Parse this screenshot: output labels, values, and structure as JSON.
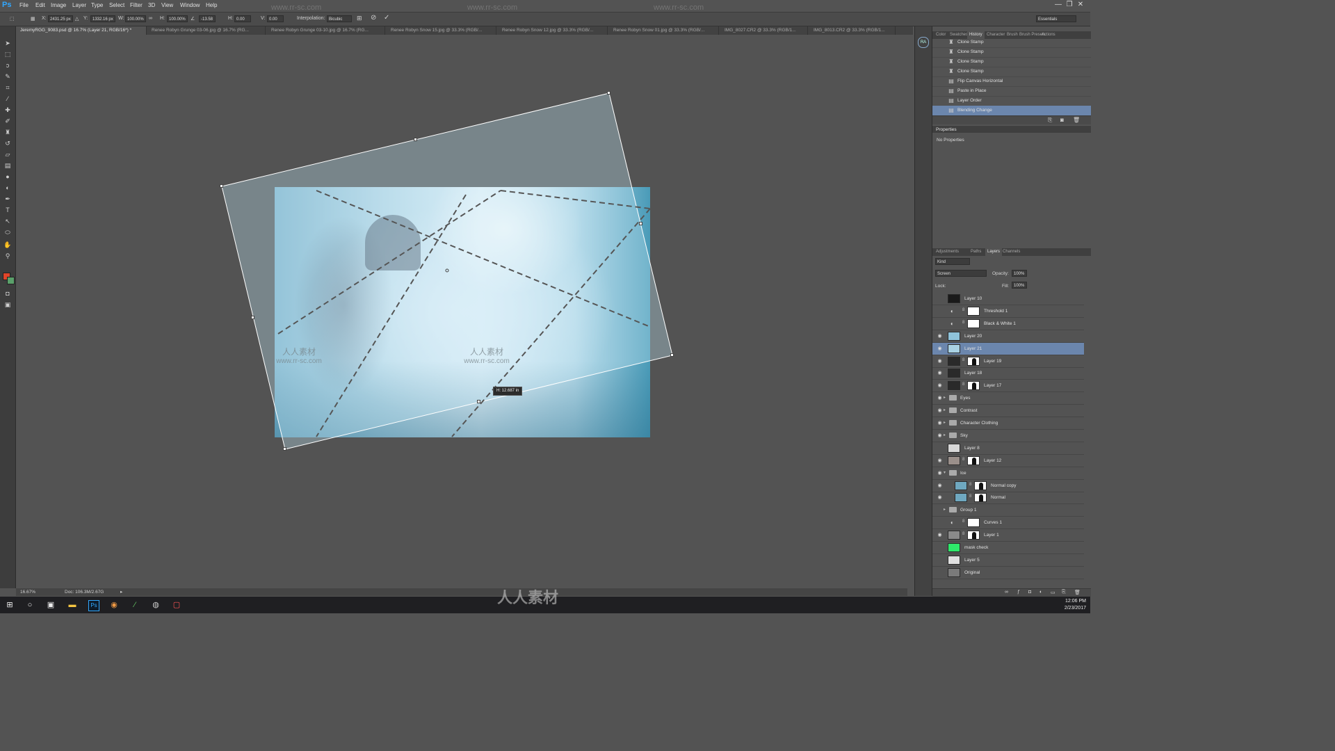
{
  "app": {
    "logo": "Ps",
    "menu": [
      "File",
      "Edit",
      "Image",
      "Layer",
      "Type",
      "Select",
      "Filter",
      "3D",
      "View",
      "Window",
      "Help"
    ],
    "window_controls": [
      "—",
      "❐",
      "✕"
    ]
  },
  "options_bar": {
    "x_label": "X:",
    "x_value": "2431.25 px",
    "y_label": "Y:",
    "y_value": "1332.16 px",
    "w_label": "W:",
    "w_value": "100.00%",
    "h_label": "H:",
    "h_value": "100.00%",
    "angle_value": "-13.58",
    "hskew_label": "H:",
    "hskew_value": "0.00",
    "vskew_label": "V:",
    "vskew_value": "0.00",
    "interpolation_label": "Interpolation:",
    "interpolation_value": "Bicubic",
    "workspace": "Essentials"
  },
  "document_tabs": [
    {
      "label": "JeremyRGG_9083.psd @ 16.7% (Layer 21, RGB/16*) *",
      "active": true
    },
    {
      "label": "Renee Robyn Grunge 03-06.jpg @ 16.7% (RG..."
    },
    {
      "label": "Renee Robyn Grunge 03-10.jpg @ 16.7% (RG..."
    },
    {
      "label": "Renee Robyn Snow 15.jpg @ 33.3% (RGB/..."
    },
    {
      "label": "Renee Robyn Snow 12.jpg @ 33.3% (RGB/..."
    },
    {
      "label": "Renee Robyn Snow 01.jpg @ 33.3% (RGB/..."
    },
    {
      "label": "IMG_8027.CR2 @ 33.3% (RGB/1..."
    },
    {
      "label": "IMG_8013.CR2 @ 33.3% (RGB/1..."
    }
  ],
  "canvas": {
    "measure_tooltip": "H: 12.687 in",
    "watermark_cn": "人人素材",
    "watermark_url": "www.rr-sc.com"
  },
  "status_bar": {
    "zoom": "16.67%",
    "doc_size": "Doc: 106.3M/2.67G"
  },
  "right_strip": {
    "ra_button": "RA"
  },
  "history_panel": {
    "tabs": [
      "Color",
      "Swatches",
      "History",
      "Character",
      "Brush",
      "Brush Presets",
      "Actions"
    ],
    "active_tab": "History",
    "items": [
      {
        "label": "Clone Stamp",
        "icon": "stamp-icon"
      },
      {
        "label": "Clone Stamp",
        "icon": "stamp-icon"
      },
      {
        "label": "Clone Stamp",
        "icon": "stamp-icon"
      },
      {
        "label": "Clone Stamp",
        "icon": "stamp-icon"
      },
      {
        "label": "Flip Canvas Horizontal",
        "icon": "doc-icon"
      },
      {
        "label": "Paste in Place",
        "icon": "doc-icon"
      },
      {
        "label": "Layer Order",
        "icon": "doc-icon"
      },
      {
        "label": "Blending Change",
        "icon": "doc-icon",
        "active": true
      }
    ]
  },
  "properties_panel": {
    "title": "Properties",
    "message": "No Properties"
  },
  "layers_panel": {
    "tabs": [
      "Adjustments",
      "Paths",
      "Layers",
      "Channels"
    ],
    "active_tab": "Layers",
    "filter_kind": "Kind",
    "blend_mode": "Screen",
    "opacity_label": "Opacity:",
    "opacity_value": "100%",
    "lock_label": "Lock:",
    "fill_label": "Fill:",
    "fill_value": "100%",
    "layers": [
      {
        "name": "Layer 10",
        "visible": false,
        "thumb": "#1a1a1a"
      },
      {
        "name": "Threshold 1",
        "visible": false,
        "adjustment": true,
        "mask": "white"
      },
      {
        "name": "Black & White 1",
        "visible": false,
        "adjustment": true,
        "mask": "white"
      },
      {
        "name": "Layer 20",
        "visible": true,
        "thumb": "#8fc3da"
      },
      {
        "name": "Layer 21",
        "visible": true,
        "thumb": "#a9d2e4",
        "active": true
      },
      {
        "name": "Layer 19",
        "visible": true,
        "thumb": "#2a2a2a",
        "mask": "dark"
      },
      {
        "name": "Layer 18",
        "visible": true,
        "thumb": "#2a2a2a"
      },
      {
        "name": "Layer 17",
        "visible": true,
        "thumb": "#2a2a2a",
        "mask": "dark"
      },
      {
        "name": "Eyes",
        "visible": true,
        "group": true
      },
      {
        "name": "Contrast",
        "visible": true,
        "group": true
      },
      {
        "name": "Character Clothing",
        "visible": true,
        "group": true
      },
      {
        "name": "Sky",
        "visible": true,
        "group": true
      },
      {
        "name": "Layer 8",
        "visible": false,
        "thumb": "#d8d8d8"
      },
      {
        "name": "Layer 12",
        "visible": true,
        "thumb": "#9a8f8a",
        "mask": "dark"
      },
      {
        "name": "Ice",
        "visible": true,
        "group": true,
        "open": true
      },
      {
        "name": "Normal copy",
        "visible": true,
        "thumb": "#6fa8c0",
        "mask": "dark",
        "indent": true
      },
      {
        "name": "Normal",
        "visible": true,
        "thumb": "#6fa8c0",
        "mask": "dark",
        "indent": true
      },
      {
        "name": "Group 1",
        "visible": false,
        "group": true
      },
      {
        "name": "Curves 1",
        "visible": false,
        "adjustment": true,
        "mask": "white"
      },
      {
        "name": "Layer 1",
        "visible": true,
        "thumb": "#8a8a8a",
        "mask": "dark"
      },
      {
        "name": "mask check",
        "visible": false,
        "thumb": "#2ee86a"
      },
      {
        "name": "Layer 5",
        "visible": false,
        "thumb": "#e0e0e0"
      },
      {
        "name": "Original",
        "visible": false,
        "thumb": "#7a7a7a"
      }
    ]
  },
  "taskbar": {
    "time": "12:06 PM",
    "date": "2/23/2017"
  },
  "colors": {
    "accent_selection": "#6b86ad",
    "foreground_swatch": "#e0452a",
    "background_swatch": "#5aa06a"
  }
}
